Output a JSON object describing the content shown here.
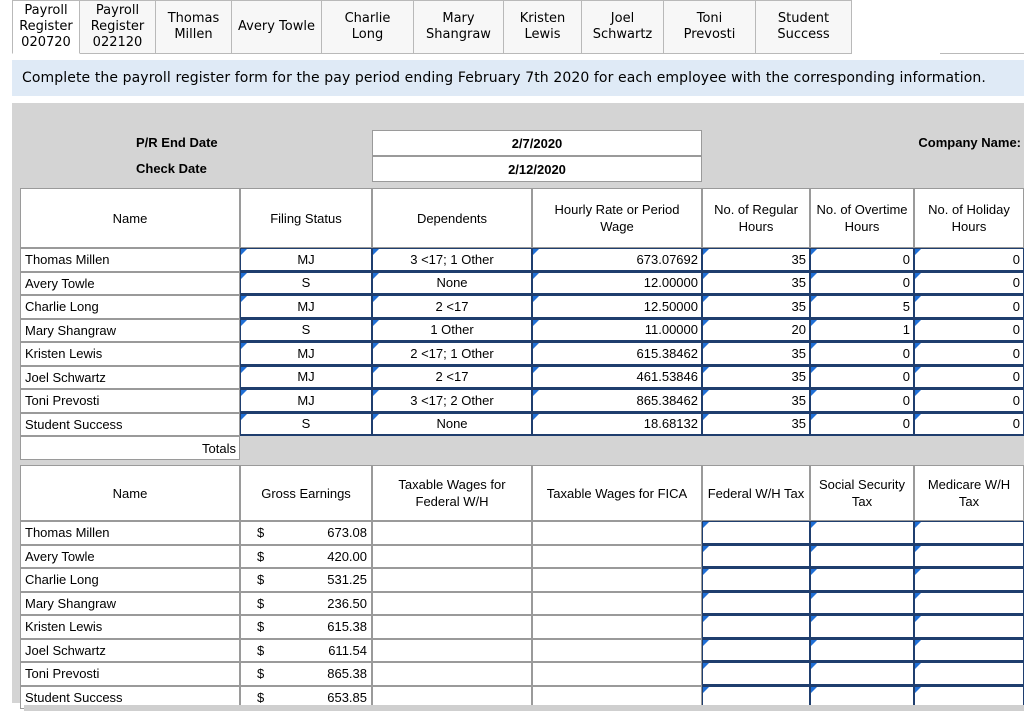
{
  "tabs": [
    {
      "label": "Payroll\nRegister\n020720",
      "w": 68
    },
    {
      "label": "Payroll\nRegister\n022120",
      "w": 76
    },
    {
      "label": "Thomas\nMillen",
      "w": 76
    },
    {
      "label": "Avery Towle",
      "w": 90
    },
    {
      "label": "Charlie Long",
      "w": 92
    },
    {
      "label": "Mary\nShangraw",
      "w": 90
    },
    {
      "label": "Kristen\nLewis",
      "w": 78
    },
    {
      "label": "Joel\nSchwartz",
      "w": 82
    },
    {
      "label": "Toni Prevosti",
      "w": 92
    },
    {
      "label": "Student\nSuccess",
      "w": 96
    }
  ],
  "instructions": "Complete the payroll register form for the pay period ending February 7th 2020 for each employee with the corresponding information.",
  "header": {
    "pr_end_label": "P/R End Date",
    "pr_end_value": "2/7/2020",
    "check_label": "Check Date",
    "check_value": "2/12/2020",
    "company_label": "Company Name:"
  },
  "table1": {
    "headers": [
      "Name",
      "Filing Status",
      "Dependents",
      "Hourly Rate or Period Wage",
      "No. of Regular Hours",
      "No. of Overtime Hours",
      "No. of Holiday Hours"
    ],
    "rows": [
      {
        "name": "Thomas Millen",
        "status": "MJ",
        "deps": "3 <17; 1 Other",
        "rate": "673.07692",
        "reg": "35",
        "ot": "0",
        "hol": "0"
      },
      {
        "name": "Avery Towle",
        "status": "S",
        "deps": "None",
        "rate": "12.00000",
        "reg": "35",
        "ot": "0",
        "hol": "0"
      },
      {
        "name": "Charlie Long",
        "status": "MJ",
        "deps": "2 <17",
        "rate": "12.50000",
        "reg": "35",
        "ot": "5",
        "hol": "0"
      },
      {
        "name": "Mary Shangraw",
        "status": "S",
        "deps": "1 Other",
        "rate": "11.00000",
        "reg": "20",
        "ot": "1",
        "hol": "0"
      },
      {
        "name": "Kristen Lewis",
        "status": "MJ",
        "deps": "2 <17; 1 Other",
        "rate": "615.38462",
        "reg": "35",
        "ot": "0",
        "hol": "0"
      },
      {
        "name": "Joel Schwartz",
        "status": "MJ",
        "deps": "2 <17",
        "rate": "461.53846",
        "reg": "35",
        "ot": "0",
        "hol": "0"
      },
      {
        "name": "Toni Prevosti",
        "status": "MJ",
        "deps": "3 <17; 2 Other",
        "rate": "865.38462",
        "reg": "35",
        "ot": "0",
        "hol": "0"
      },
      {
        "name": "Student Success",
        "status": "S",
        "deps": "None",
        "rate": "18.68132",
        "reg": "35",
        "ot": "0",
        "hol": "0"
      }
    ],
    "totals_label": "Totals"
  },
  "table2": {
    "headers": [
      "Name",
      "Gross Earnings",
      "Taxable Wages for Federal W/H",
      "Taxable Wages for FICA",
      "Federal W/H Tax",
      "Social Security Tax",
      "Medicare W/H Tax"
    ],
    "currency": "$",
    "rows": [
      {
        "name": "Thomas Millen",
        "gross": "673.08"
      },
      {
        "name": "Avery Towle",
        "gross": "420.00"
      },
      {
        "name": "Charlie Long",
        "gross": "531.25"
      },
      {
        "name": "Mary Shangraw",
        "gross": "236.50"
      },
      {
        "name": "Kristen Lewis",
        "gross": "615.38"
      },
      {
        "name": "Joel Schwartz",
        "gross": "611.54"
      },
      {
        "name": "Toni Prevosti",
        "gross": "865.38"
      },
      {
        "name": "Student Success",
        "gross": "653.85"
      }
    ]
  }
}
